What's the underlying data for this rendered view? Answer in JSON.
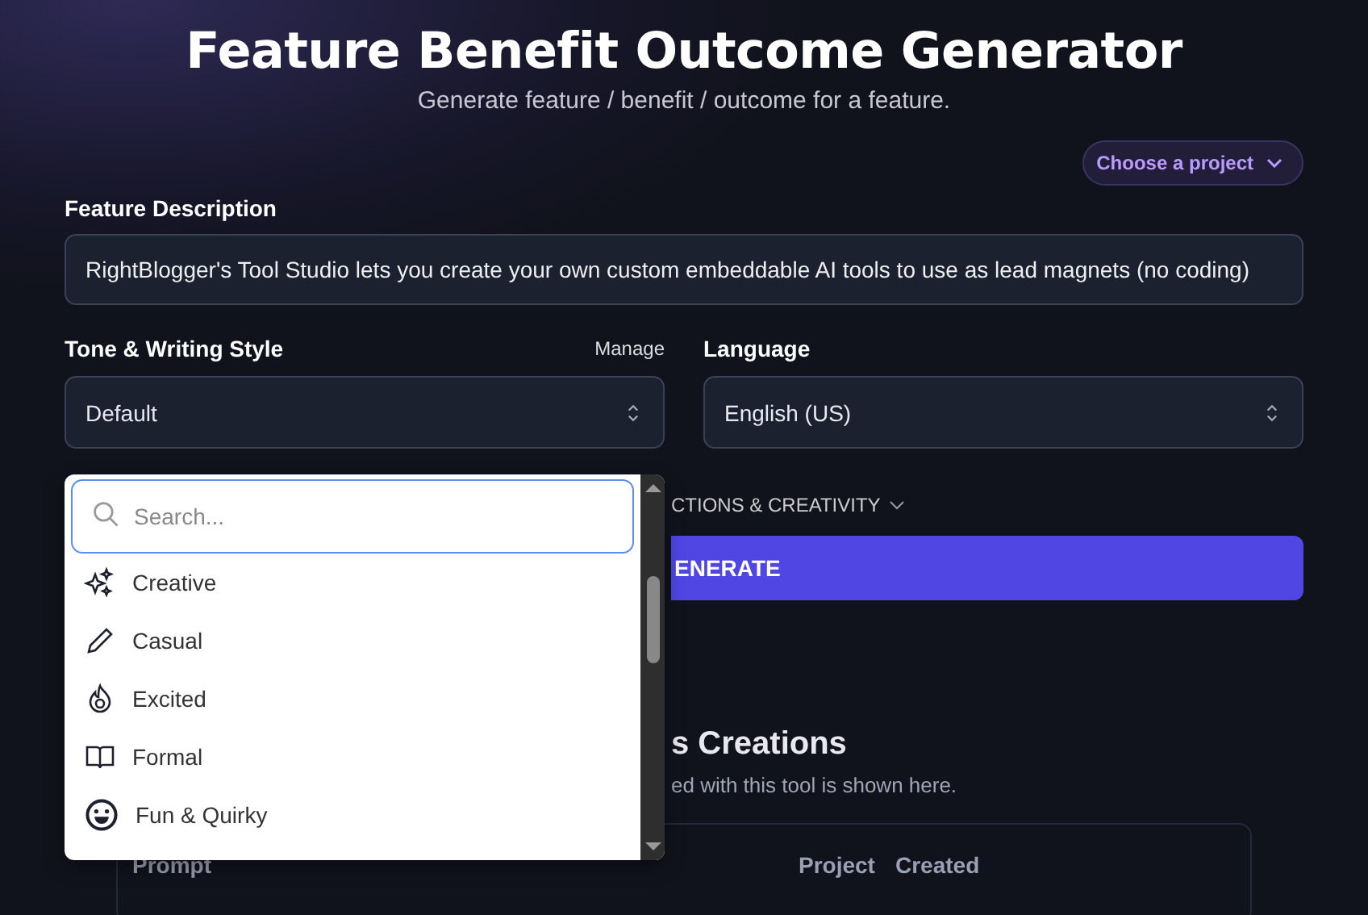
{
  "header": {
    "title": "Feature Benefit Outcome Generator",
    "subtitle": "Generate feature / benefit / outcome for a feature."
  },
  "project_picker": {
    "label": "Choose a project"
  },
  "feature": {
    "label": "Feature Description",
    "value": "RightBlogger's Tool Studio lets you create your own custom embeddable AI tools to use as lead magnets (no coding)"
  },
  "tone": {
    "label": "Tone & Writing Style",
    "manage": "Manage",
    "value": "Default"
  },
  "language": {
    "label": "Language",
    "value": "English (US)"
  },
  "dropdown": {
    "search_placeholder": "Search...",
    "items": [
      {
        "label": "Creative",
        "kind": "sparkles"
      },
      {
        "label": "Casual",
        "kind": "pencil"
      },
      {
        "label": "Excited",
        "kind": "fire"
      },
      {
        "label": "Formal",
        "kind": "book"
      },
      {
        "label": "Fun & Quirky",
        "kind": "smile"
      }
    ]
  },
  "options_toggle": "CTIONS & CREATIVITY",
  "generate_button": "ENERATE",
  "creations": {
    "title": "s Creations",
    "subtitle": "ed with this tool is shown here.",
    "columns": [
      "Prompt",
      "Project",
      "Created"
    ]
  }
}
